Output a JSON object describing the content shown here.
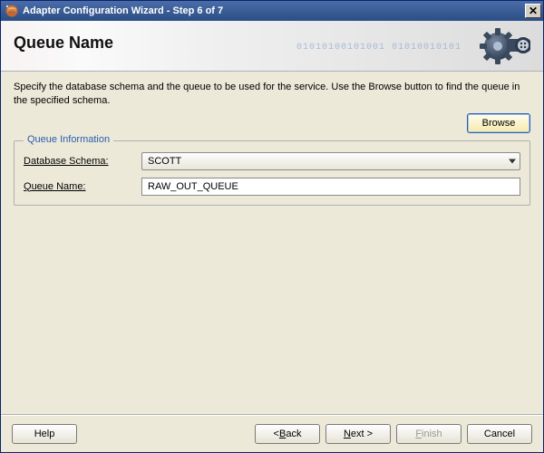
{
  "window": {
    "title": "Adapter Configuration Wizard - Step 6 of 7",
    "close_glyph": "✕"
  },
  "header": {
    "page_title": "Queue Name",
    "bits_decoration": "01010100101001  01010010101"
  },
  "instructions": "Specify the database schema and the queue to be used for the service. Use the Browse button to find the queue in the specified schema.",
  "browse": {
    "label": "Browse"
  },
  "group": {
    "legend": "Queue Information",
    "schema_label_pre": "D",
    "schema_label_rest": "atabase Schema:",
    "schema_value": "SCOTT",
    "queue_label_pre": "Q",
    "queue_label_rest": "ueue Name:",
    "queue_value": "RAW_OUT_QUEUE"
  },
  "footer": {
    "help": "Help",
    "back_pre": "< ",
    "back_accel": "B",
    "back_rest": "ack",
    "next_accel": "N",
    "next_rest": "ext >",
    "finish_accel": "F",
    "finish_rest": "inish",
    "cancel": "Cancel"
  }
}
